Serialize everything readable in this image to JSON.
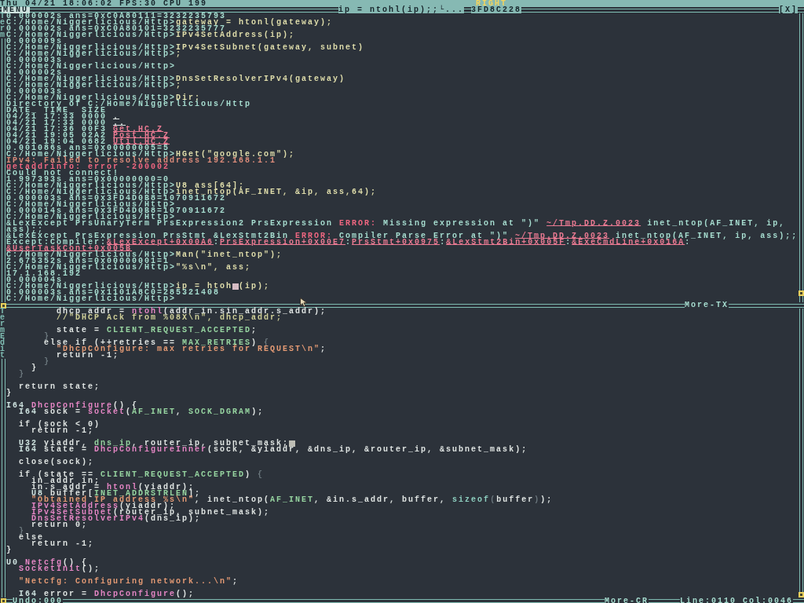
{
  "top_bar": {
    "status": "Thu 04/21 18:06:02 FPS:30 CPU 199",
    "mouse_button": "RIGHT"
  },
  "terminal": {
    "menu": "MENU",
    "title": "ip = ntohl(ip);;└...",
    "address": "3FD8C228",
    "close": "[X]",
    "side_title": "Term",
    "footer": "More-TX",
    "lines": [
      {
        "parts": [
          {
            "text": "0.000002s ans=0xC0A80111=3232235793",
            "kind": "output"
          }
        ]
      },
      {
        "parts": [
          {
            "text": "C:/Home/Niggerlicious/Http>",
            "kind": "prompt"
          },
          {
            "text": "gateway = htonl(gateway);",
            "kind": "command"
          }
        ]
      },
      {
        "parts": [
          {
            "text": "0.000002s ans=0xC0A80101=3232235777",
            "kind": "output"
          }
        ]
      },
      {
        "parts": [
          {
            "text": "C:/Home/Niggerlicious/Http>",
            "kind": "prompt"
          },
          {
            "text": "IPv4SetAddress(ip);",
            "kind": "command"
          }
        ]
      },
      {
        "parts": [
          {
            "text": "0.000009s",
            "kind": "output"
          }
        ]
      },
      {
        "parts": [
          {
            "text": "C:/Home/Niggerlicious/Http>",
            "kind": "prompt"
          },
          {
            "text": "IPv4SetSubnet(gateway, subnet)",
            "kind": "command"
          }
        ]
      },
      {
        "parts": [
          {
            "text": "C:/Home/Niggerlicious/Http>",
            "kind": "prompt"
          },
          {
            "text": ";",
            "kind": "command"
          }
        ]
      },
      {
        "parts": [
          {
            "text": "0.000003s",
            "kind": "output"
          }
        ]
      },
      {
        "parts": [
          {
            "text": "C:/Home/Niggerlicious/Http>",
            "kind": "prompt"
          }
        ]
      },
      {
        "parts": [
          {
            "text": "0.000002s",
            "kind": "output"
          }
        ]
      },
      {
        "parts": [
          {
            "text": "C:/Home/Niggerlicious/Http>",
            "kind": "prompt"
          },
          {
            "text": "DnsSetResolverIPv4(gateway)",
            "kind": "command"
          }
        ]
      },
      {
        "parts": [
          {
            "text": "C:/Home/Niggerlicious/Http>",
            "kind": "prompt"
          },
          {
            "text": ";",
            "kind": "command"
          }
        ]
      },
      {
        "parts": [
          {
            "text": "0.000003s",
            "kind": "output"
          }
        ]
      },
      {
        "parts": [
          {
            "text": "C:/Home/Niggerlicious/Http>",
            "kind": "prompt"
          },
          {
            "text": "Dir;",
            "kind": "command"
          }
        ]
      },
      {
        "parts": [
          {
            "text": "Directory of C:/Home/Niggerlicious/Http",
            "kind": "output"
          }
        ]
      },
      {
        "parts": [
          {
            "text": "DATE_ TIME_ SIZE",
            "kind": "output"
          }
        ]
      },
      {
        "parts": [
          {
            "text": "04/21 17:33 0000 ",
            "kind": "output"
          },
          {
            "text": ".",
            "kind": "folder_link"
          }
        ]
      },
      {
        "parts": [
          {
            "text": "04/21 17:33 0000 ",
            "kind": "output"
          },
          {
            "text": "..",
            "kind": "folder_link"
          }
        ]
      },
      {
        "parts": [
          {
            "text": "04/21 17:36 00F3 ",
            "kind": "output"
          },
          {
            "text": "Get.HC.Z",
            "kind": "file_link"
          }
        ]
      },
      {
        "parts": [
          {
            "text": "04/21 19:05 02A2 ",
            "kind": "output"
          },
          {
            "text": "Post.HC.Z",
            "kind": "file_link"
          }
        ]
      },
      {
        "parts": [
          {
            "text": "04/21 19:04 0682 ",
            "kind": "output"
          },
          {
            "text": "Util.HC.Z",
            "kind": "file_link"
          }
        ]
      },
      {
        "parts": [
          {
            "text": "0.001086s ans=0x00000005=5",
            "kind": "output"
          }
        ]
      },
      {
        "parts": [
          {
            "text": "C:/Home/Niggerlicious/Http>",
            "kind": "prompt"
          },
          {
            "text": "HGet(\"google.com\");",
            "kind": "command"
          }
        ]
      },
      {
        "parts": [
          {
            "text": "IPv4: Failed to resolve address 192.168.1.1",
            "kind": "warning"
          }
        ]
      },
      {
        "parts": [
          {
            "text": "getaddrinfo: error -200002",
            "kind": "error"
          }
        ]
      },
      {
        "parts": [
          {
            "text": "Could not connect!",
            "kind": "output"
          }
        ]
      },
      {
        "parts": [
          {
            "text": "1.997393s ans=0x00000000=0",
            "kind": "output"
          }
        ]
      },
      {
        "parts": [
          {
            "text": "C:/Home/Niggerlicious/Http>",
            "kind": "prompt"
          },
          {
            "text": "U8 ass[64];",
            "kind": "command"
          }
        ]
      },
      {
        "parts": [
          {
            "text": "C:/Home/Niggerlicious/Http>",
            "kind": "prompt"
          },
          {
            "text": "inet_ntop(AF_INET, &ip, ass,64);",
            "kind": "command"
          }
        ]
      },
      {
        "parts": [
          {
            "text": "0.000003s ans=0x3FD4D0B8=1070911672",
            "kind": "output"
          }
        ]
      },
      {
        "parts": [
          {
            "text": "C:/Home/Niggerlicious/Http>",
            "kind": "prompt"
          }
        ]
      },
      {
        "parts": [
          {
            "text": "0.000014s ans=0x3FD4D0B8=1070911672",
            "kind": "output"
          }
        ]
      },
      {
        "parts": [
          {
            "text": "C:/Home/Niggerlicious/Http>",
            "kind": "prompt"
          }
        ]
      },
      {
        "parts": [
          {
            "text": "&LexExcept PrsUnaryTerm PrsExpression2 PrsExpression ",
            "kind": "output"
          },
          {
            "text": "ERROR:",
            "kind": "error"
          },
          {
            "text": " Missing expression at \")\" ",
            "kind": "output"
          },
          {
            "text": "~/Tmp.DD.Z.0023",
            "kind": "source_link"
          },
          {
            "text": " inet_ntop(AF_INET, ip,",
            "kind": "output"
          }
        ]
      },
      {
        "parts": [
          {
            "text": "ass);;",
            "kind": "output"
          }
        ]
      },
      {
        "parts": [
          {
            "text": "&LexExcept PrsExpression PrsStmt &LexStmt2Bin ",
            "kind": "output"
          },
          {
            "text": "ERROR:",
            "kind": "error"
          },
          {
            "text": " Compiler Parse Error at \")\" ",
            "kind": "output"
          },
          {
            "text": "~/Tmp.DD.Z.0023",
            "kind": "source_link"
          },
          {
            "text": " inet_ntop(AF_INET, ip, ass);;",
            "kind": "output"
          }
        ]
      },
      {
        "parts": [
          {
            "text": "Except:Compiler:",
            "kind": "output"
          },
          {
            "text": "&LexExcept+0x00A6",
            "kind": "trace_link"
          },
          {
            "text": ":",
            "kind": "output"
          },
          {
            "text": "PrsExpression+0x00E7",
            "kind": "trace_link"
          },
          {
            "text": ":",
            "kind": "output"
          },
          {
            "text": "PrsStmt+0x0975",
            "kind": "trace_link"
          },
          {
            "text": ":",
            "kind": "output"
          },
          {
            "text": "&LexStmt2Bin+0x005F",
            "kind": "trace_link"
          },
          {
            "text": ":",
            "kind": "output"
          },
          {
            "text": "&ExeCmdLine+0x016A",
            "kind": "trace_link"
          },
          {
            "text": ":",
            "kind": "output"
          }
        ]
      },
      {
        "parts": [
          {
            "text": "&UserTaskCont+0x005B",
            "kind": "trace_link"
          }
        ]
      },
      {
        "parts": [
          {
            "text": "C:/Home/Niggerlicious/Http>",
            "kind": "prompt"
          },
          {
            "text": "Man(\"inet_ntop\");",
            "kind": "command"
          }
        ]
      },
      {
        "parts": [
          {
            "text": "2.675352s ans=0x00000001=1",
            "kind": "output"
          }
        ]
      },
      {
        "parts": [
          {
            "text": "C:/Home/Niggerlicious/Http>",
            "kind": "prompt"
          },
          {
            "text": "\"%s\\n\", ass;",
            "kind": "command"
          }
        ]
      },
      {
        "parts": [
          {
            "text": "17.1.168.192",
            "kind": "output"
          }
        ]
      },
      {
        "parts": [
          {
            "text": "0.000004s",
            "kind": "output"
          }
        ]
      },
      {
        "parts": [
          {
            "text": "C:/Home/Niggerlicious/Http>",
            "kind": "prompt"
          },
          {
            "text": "ip = htoh",
            "kind": "command"
          },
          {
            "kind": "cursor"
          },
          {
            "text": "(ip);",
            "kind": "command"
          }
        ]
      },
      {
        "parts": [
          {
            "text": "0.000003s ans=0x1101A8C0=285321408",
            "kind": "output"
          }
        ]
      },
      {
        "parts": [
          {
            "text": "C:/Home/Niggerlicious/Http>",
            "kind": "prompt"
          }
        ]
      }
    ]
  },
  "editor": {
    "side_title": "TermEdit",
    "lines": [
      {
        "kind": "code",
        "parts": [
          {
            "text": "        dhcp_addr = ",
            "kind": "plain"
          },
          {
            "text": "ntohl",
            "kind": "function"
          },
          {
            "text": "(addr_in.sin_addr.s_addr);",
            "kind": "plain"
          }
        ]
      },
      {
        "kind": "code",
        "parts": [
          {
            "text": "        //\"DHCP Ack from %08X\\n\", dhcp_addr;",
            "kind": "comment"
          }
        ]
      },
      {
        "kind": "blank"
      },
      {
        "kind": "code",
        "parts": [
          {
            "text": "        state = ",
            "kind": "plain"
          },
          {
            "text": "CLIENT_REQUEST_ACCEPTED",
            "kind": "constant"
          },
          {
            "text": ";",
            "kind": "plain"
          }
        ]
      },
      {
        "kind": "code",
        "parts": [
          {
            "text": "      }",
            "kind": "brace"
          }
        ]
      },
      {
        "kind": "code",
        "parts": [
          {
            "text": "      else if (++retries == ",
            "kind": "plain"
          },
          {
            "text": "MAX_RETRIES",
            "kind": "constant"
          },
          {
            "text": ") ",
            "kind": "plain"
          },
          {
            "text": "{",
            "kind": "brace"
          }
        ]
      },
      {
        "kind": "code",
        "parts": [
          {
            "text": "        \"DhcpConfigure: max retries for REQUEST\\n\"",
            "kind": "string"
          },
          {
            "text": ";",
            "kind": "plain"
          }
        ]
      },
      {
        "kind": "code",
        "parts": [
          {
            "text": "        return -1;",
            "kind": "plain"
          }
        ]
      },
      {
        "kind": "code",
        "parts": [
          {
            "text": "      }",
            "kind": "brace"
          }
        ]
      },
      {
        "kind": "code",
        "parts": [
          {
            "text": "    }",
            "kind": "plain"
          }
        ]
      },
      {
        "kind": "code",
        "parts": [
          {
            "text": "  }",
            "kind": "brace"
          }
        ]
      },
      {
        "kind": "blank"
      },
      {
        "kind": "code",
        "parts": [
          {
            "text": "  return state;",
            "kind": "plain"
          }
        ]
      },
      {
        "kind": "code",
        "parts": [
          {
            "text": "}",
            "kind": "plain"
          }
        ]
      },
      {
        "kind": "blank"
      },
      {
        "kind": "code",
        "parts": [
          {
            "text": "I64 ",
            "kind": "type"
          },
          {
            "text": "DhcpConfigure",
            "kind": "function"
          },
          {
            "text": "() {",
            "kind": "plain"
          }
        ]
      },
      {
        "kind": "code",
        "parts": [
          {
            "text": "  I64 ",
            "kind": "type"
          },
          {
            "text": "sock = ",
            "kind": "plain"
          },
          {
            "text": "socket",
            "kind": "function"
          },
          {
            "text": "(",
            "kind": "plain"
          },
          {
            "text": "AF_INET",
            "kind": "constant"
          },
          {
            "text": ", ",
            "kind": "plain"
          },
          {
            "text": "SOCK_DGRAM",
            "kind": "constant"
          },
          {
            "text": ");",
            "kind": "plain"
          }
        ]
      },
      {
        "kind": "blank"
      },
      {
        "kind": "code",
        "parts": [
          {
            "text": "  if (sock < 0)",
            "kind": "plain"
          }
        ]
      },
      {
        "kind": "code",
        "parts": [
          {
            "text": "    return -1;",
            "kind": "plain"
          }
        ]
      },
      {
        "kind": "blank"
      },
      {
        "kind": "code",
        "parts": [
          {
            "text": "  U32 ",
            "kind": "type"
          },
          {
            "text": "yiaddr, ",
            "kind": "plain"
          },
          {
            "text": "dns_ip",
            "kind": "global"
          },
          {
            "text": ", router_ip, subnet_mask;",
            "kind": "plain"
          },
          {
            "kind": "cursor"
          }
        ]
      },
      {
        "kind": "code",
        "parts": [
          {
            "text": "  I64 ",
            "kind": "type"
          },
          {
            "text": "state = ",
            "kind": "plain"
          },
          {
            "text": "DhcpConfigureInner",
            "kind": "function"
          },
          {
            "text": "(sock, &yiaddr, &dns_ip, &router_ip, &subnet_mask);",
            "kind": "plain"
          }
        ]
      },
      {
        "kind": "blank"
      },
      {
        "kind": "code",
        "parts": [
          {
            "text": "  close(sock);",
            "kind": "plain"
          }
        ]
      },
      {
        "kind": "blank"
      },
      {
        "kind": "code",
        "parts": [
          {
            "text": "  if (state == ",
            "kind": "plain"
          },
          {
            "text": "CLIENT_REQUEST_ACCEPTED",
            "kind": "constant"
          },
          {
            "text": ") ",
            "kind": "plain"
          },
          {
            "text": "{",
            "kind": "brace"
          }
        ]
      },
      {
        "kind": "code",
        "parts": [
          {
            "text": "    in_addr in;",
            "kind": "plain"
          }
        ]
      },
      {
        "kind": "code",
        "parts": [
          {
            "text": "    in.s_addr = ",
            "kind": "plain"
          },
          {
            "text": "htonl",
            "kind": "function"
          },
          {
            "text": "(yiaddr);",
            "kind": "plain"
          }
        ]
      },
      {
        "kind": "code",
        "parts": [
          {
            "text": "    U8 ",
            "kind": "type"
          },
          {
            "text": "buffer[",
            "kind": "plain"
          },
          {
            "text": "INET_ADDRSTRLEN",
            "kind": "constant"
          },
          {
            "text": "];",
            "kind": "plain"
          }
        ]
      },
      {
        "kind": "code",
        "parts": [
          {
            "text": "    \"Obtained IP address %s\\n\"",
            "kind": "string"
          },
          {
            "text": ", inet_ntop(",
            "kind": "plain"
          },
          {
            "text": "AF_INET",
            "kind": "constant"
          },
          {
            "text": ", &in.s_addr, buffer, ",
            "kind": "plain"
          },
          {
            "text": "sizeof",
            "kind": "keyword"
          },
          {
            "text": "(",
            "kind": "brace"
          },
          {
            "text": "buffer",
            "kind": "plain"
          },
          {
            "text": ")",
            "kind": "brace"
          },
          {
            "text": ");",
            "kind": "plain"
          }
        ]
      },
      {
        "kind": "code",
        "parts": [
          {
            "text": "    IPv4SetAddress",
            "kind": "function"
          },
          {
            "text": "(yiaddr);",
            "kind": "plain"
          }
        ]
      },
      {
        "kind": "code",
        "parts": [
          {
            "text": "    IPv4SetSubnet",
            "kind": "function"
          },
          {
            "text": "(router_ip, subnet_mask);",
            "kind": "plain"
          }
        ]
      },
      {
        "kind": "code",
        "parts": [
          {
            "text": "    DnsSetResolverIPv4",
            "kind": "function"
          },
          {
            "text": "(dns_ip);",
            "kind": "plain"
          }
        ]
      },
      {
        "kind": "code",
        "parts": [
          {
            "text": "    return 0;",
            "kind": "plain"
          }
        ]
      },
      {
        "kind": "code",
        "parts": [
          {
            "text": "  }",
            "kind": "brace"
          }
        ]
      },
      {
        "kind": "code",
        "parts": [
          {
            "text": "  else",
            "kind": "plain"
          }
        ]
      },
      {
        "kind": "code",
        "parts": [
          {
            "text": "    return -1;",
            "kind": "plain"
          }
        ]
      },
      {
        "kind": "code",
        "parts": [
          {
            "text": "}",
            "kind": "plain"
          }
        ]
      },
      {
        "kind": "blank"
      },
      {
        "kind": "code",
        "parts": [
          {
            "text": "U0 ",
            "kind": "type"
          },
          {
            "text": "Netcfg",
            "kind": "function"
          },
          {
            "text": "() {",
            "kind": "plain"
          }
        ]
      },
      {
        "kind": "code",
        "parts": [
          {
            "text": "  SocketInit",
            "kind": "function"
          },
          {
            "text": "();",
            "kind": "plain"
          }
        ]
      },
      {
        "kind": "blank"
      },
      {
        "kind": "code",
        "parts": [
          {
            "text": "  \"Netcfg: Configuring network...\\n\"",
            "kind": "string"
          },
          {
            "text": ";",
            "kind": "plain"
          }
        ]
      },
      {
        "kind": "blank"
      },
      {
        "kind": "code",
        "parts": [
          {
            "text": "  I64 ",
            "kind": "type"
          },
          {
            "text": "error = ",
            "kind": "plain"
          },
          {
            "text": "DhcpConfigure",
            "kind": "function"
          },
          {
            "text": "();",
            "kind": "plain"
          }
        ]
      }
    ],
    "status_bar": {
      "undo": "Undo:000",
      "pager": "More-CR",
      "position": "Line:0110 Col:0046"
    }
  }
}
